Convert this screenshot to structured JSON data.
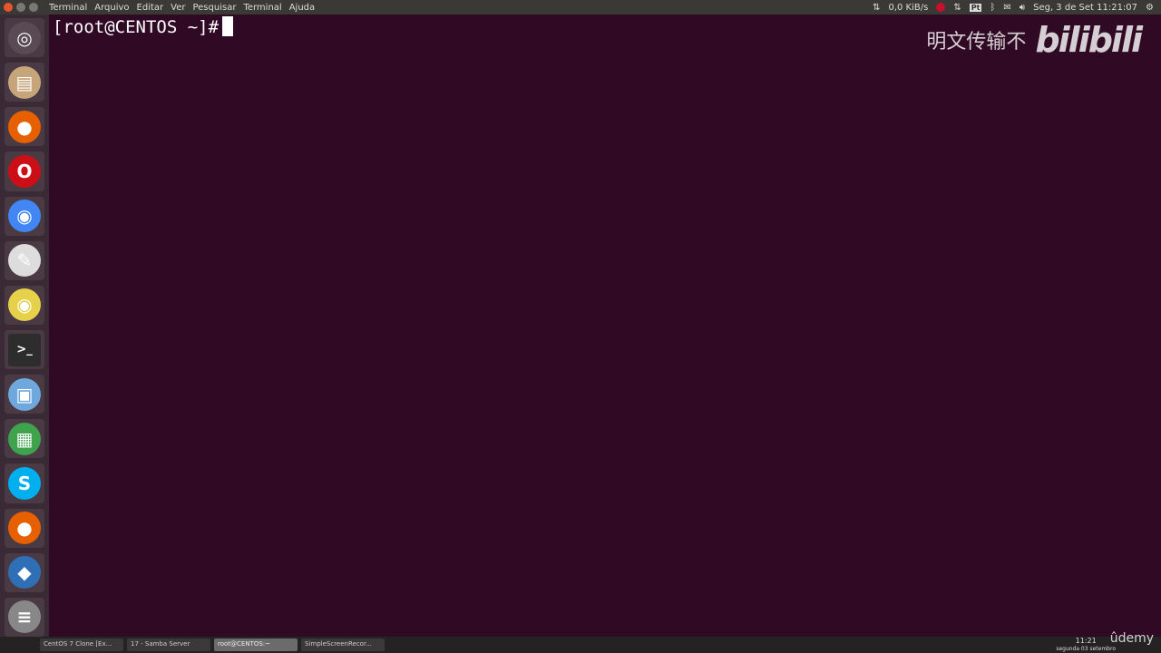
{
  "topbar": {
    "menu": [
      "Terminal",
      "Arquivo",
      "Editar",
      "Ver",
      "Pesquisar",
      "Terminal",
      "Ajuda"
    ],
    "network_speed": "0,0 KiB/s",
    "keyboard_layout": "Pt",
    "datetime": "Seg, 3 de Set 11:21:07"
  },
  "launcher": [
    {
      "name": "ubuntu-dash-icon",
      "glyph": "◎",
      "color": "#5a4a55"
    },
    {
      "name": "files-icon",
      "glyph": "▤",
      "color": "#c7a57a"
    },
    {
      "name": "firefox-icon",
      "glyph": "●",
      "color": "#e66000"
    },
    {
      "name": "opera-icon",
      "glyph": "O",
      "color": "#cc0f16"
    },
    {
      "name": "chrome-icon",
      "glyph": "◉",
      "color": "#4285f4"
    },
    {
      "name": "text-editor-icon",
      "glyph": "✎",
      "color": "#ddd"
    },
    {
      "name": "rhythmbox-icon",
      "glyph": "◉",
      "color": "#e8d14a"
    },
    {
      "name": "terminal-icon",
      "glyph": ">_",
      "color": "#2d2d2d"
    },
    {
      "name": "image-viewer-icon",
      "glyph": "▣",
      "color": "#6fa8dc"
    },
    {
      "name": "spreadsheet-icon",
      "glyph": "▦",
      "color": "#3fa34d"
    },
    {
      "name": "skype-icon",
      "glyph": "S",
      "color": "#00aff0"
    },
    {
      "name": "firefox-icon-2",
      "glyph": "●",
      "color": "#e66000"
    },
    {
      "name": "virtualbox-icon",
      "glyph": "◆",
      "color": "#2f6fb5"
    },
    {
      "name": "drive-icon",
      "glyph": "≡",
      "color": "#888"
    }
  ],
  "terminal": {
    "prompt": "[root@CENTOS ~]#"
  },
  "watermark": {
    "chinese": "明文传输不",
    "logo": "bilibili"
  },
  "taskbar": {
    "tasks": [
      "CentOS 7 Clone [Ex...",
      "17 - Samba Server",
      "root@CENTOS:~",
      "SimpleScreenRecor..."
    ],
    "time": "11:21",
    "date": "segunda 03 setembro",
    "brand": "ûdemy"
  }
}
